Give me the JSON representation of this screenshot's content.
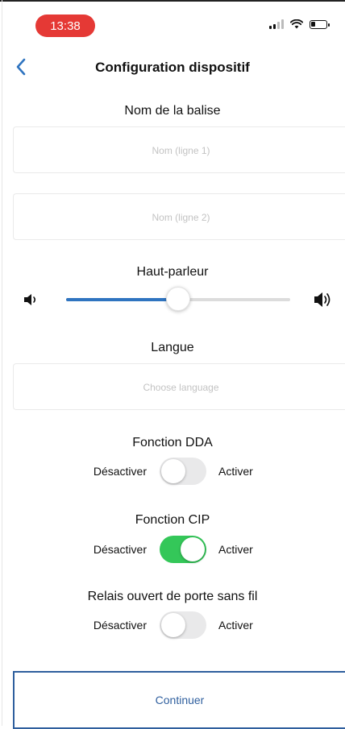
{
  "status_bar": {
    "time": "13:38",
    "time_pill_color": "#e53935"
  },
  "header": {
    "back_icon": "chevron-left-icon",
    "title": "Configuration dispositif"
  },
  "beacon_name": {
    "label": "Nom de la balise",
    "line1": {
      "value": "",
      "placeholder": "Nom (ligne 1)"
    },
    "line2": {
      "value": "",
      "placeholder": "Nom (ligne 2)"
    }
  },
  "speaker": {
    "label": "Haut-parleur",
    "volume_fraction": 0.5,
    "low_icon": "speaker-low-icon",
    "high_icon": "speaker-high-icon"
  },
  "language": {
    "label": "Langue",
    "value": "",
    "placeholder": "Choose language"
  },
  "dda": {
    "label": "Fonction DDA",
    "off_label": "Désactiver",
    "on_label": "Activer",
    "enabled": false
  },
  "cip": {
    "label": "Fonction CIP",
    "off_label": "Désactiver",
    "on_label": "Activer",
    "enabled": true
  },
  "relay": {
    "label": "Relais ouvert de porte sans fil",
    "off_label": "Désactiver",
    "on_label": "Activer",
    "enabled": false
  },
  "continue_label": "Continuer",
  "colors": {
    "accent": "#2f74c0",
    "toggle_on": "#34c759",
    "button_border": "#2f5f9e"
  }
}
